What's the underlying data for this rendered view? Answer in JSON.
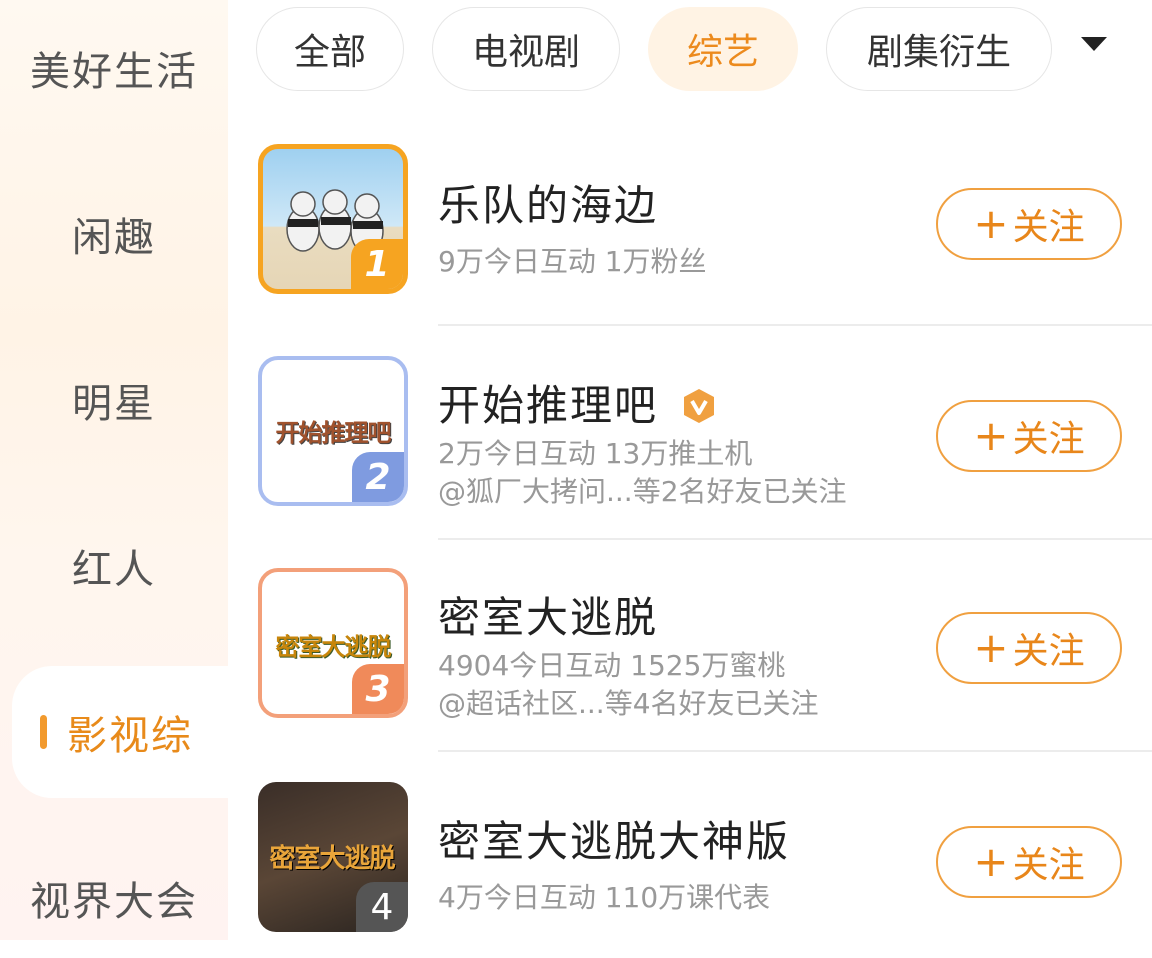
{
  "sidebar": {
    "items": [
      {
        "label": "美好生活"
      },
      {
        "label": "闲趣"
      },
      {
        "label": "明星"
      },
      {
        "label": "红人"
      },
      {
        "label": "影视综",
        "active": true
      },
      {
        "label": "视界大会"
      }
    ]
  },
  "tabs": [
    {
      "label": "全部"
    },
    {
      "label": "电视剧"
    },
    {
      "label": "综艺",
      "active": true
    },
    {
      "label": "剧集衍生"
    }
  ],
  "dropdown_icon": "caret-down-icon",
  "follow_label": "关注",
  "list": [
    {
      "rank": "1",
      "title": "乐队的海边",
      "stats": "9万今日互动 1万粉丝",
      "friends": "",
      "verified": false,
      "thumb_text": ""
    },
    {
      "rank": "2",
      "title": "开始推理吧",
      "stats": "2万今日互动 13万推土机",
      "friends": "@狐厂大拷问...等2名好友已关注",
      "verified": true,
      "thumb_text": "开始推理吧"
    },
    {
      "rank": "3",
      "title": "密室大逃脱",
      "stats": "4904今日互动 1525万蜜桃",
      "friends": "@超话社区...等4名好友已关注",
      "verified": false,
      "thumb_text": "密室大逃脱"
    },
    {
      "rank": "4",
      "title": "密室大逃脱大神版",
      "stats": "4万今日互动 110万课代表",
      "friends": "",
      "verified": false,
      "thumb_text": "密室大逃脱"
    }
  ],
  "colors": {
    "accent": "#ec8a1d",
    "rank1": "#f6a421",
    "rank2": "#7f9be0",
    "rank3": "#f08a5a",
    "rank4": "#555555"
  }
}
